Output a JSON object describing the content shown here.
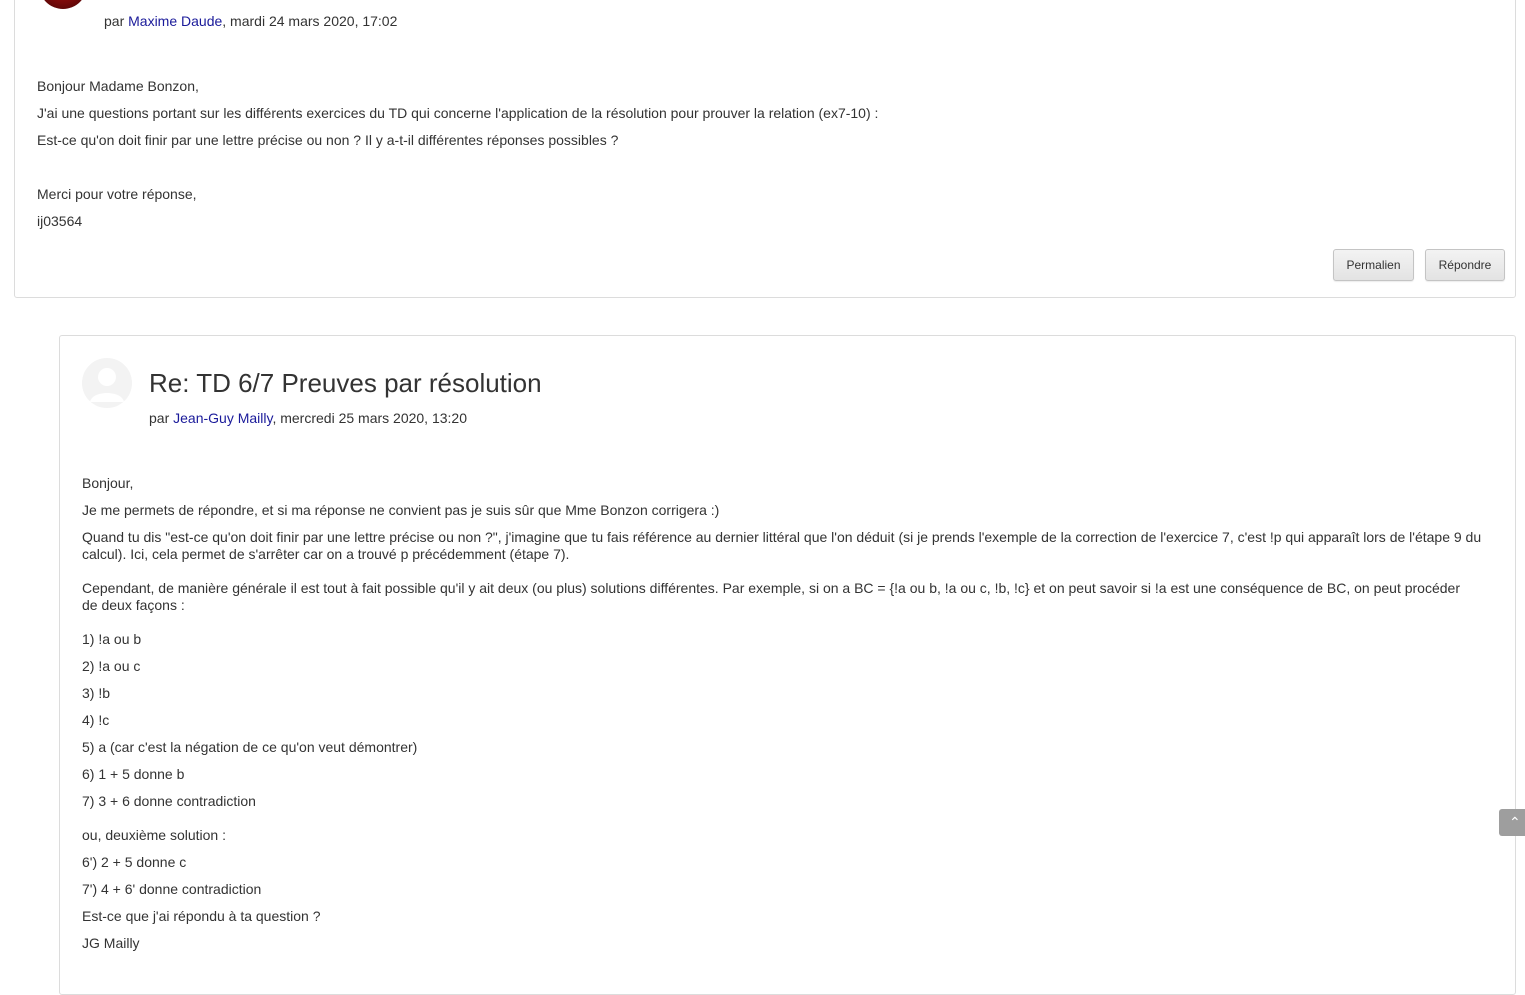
{
  "post1": {
    "byline_prefix": "par",
    "author": "Maxime Daude",
    "date": ", mardi 24 mars 2020, 17:02",
    "paragraphs": [
      "Bonjour Madame Bonzon,",
      "J'ai une questions portant sur les différents exercices du TD qui concerne l'application de la résolution pour prouver la relation (ex7-10) :",
      "Est-ce qu'on doit finir par une lettre précise ou non ? Il y a-t-il différentes réponses possibles ?",
      "Merci pour votre réponse,",
      "ij03564"
    ],
    "permalink_label": "Permalien",
    "reply_label": "Répondre"
  },
  "post2": {
    "subject": "Re: TD 6/7 Preuves par résolution",
    "byline_prefix": "par",
    "author": "Jean-Guy Mailly",
    "date": ", mercredi 25 mars 2020, 13:20",
    "paragraphs": [
      "Bonjour,",
      "Je me permets de répondre, et si ma réponse ne convient pas je suis sûr que Mme Bonzon corrigera :)",
      "Quand tu dis \"est-ce qu'on doit finir par une lettre précise ou non ?\", j'imagine que tu fais référence au dernier littéral que l'on déduit (si je prends l'exemple de la correction de l'exercice 7, c'est !p qui apparaît lors de l'étape 9 du calcul). Ici, cela permet de s'arrêter car on a trouvé p précédemment (étape 7).",
      "Cependant, de manière générale il est tout à fait possible qu'il y ait deux (ou plus) solutions différentes. Par exemple, si on a BC = {!a ou b, !a ou c, !b, !c} et on peut savoir si !a est une conséquence de BC, on peut procéder de deux façons :",
      "1) !a ou b",
      "2) !a ou c",
      "3) !b",
      "4) !c",
      "5) a (car c'est la négation de ce qu'on veut démontrer)",
      "6) 1 + 5 donne b",
      "7) 3 + 6 donne contradiction",
      "ou, deuxième solution :",
      "6') 2 + 5 donne c",
      "7') 4 + 6' donne contradiction",
      "Est-ce que j'ai répondu à ta question ?",
      "JG Mailly"
    ]
  },
  "scroll_top_icon": "chevron-up-icon",
  "colors": {
    "link": "#1a1a9a",
    "border": "#dcdcdc",
    "button_bg": "#e8e8e8"
  }
}
